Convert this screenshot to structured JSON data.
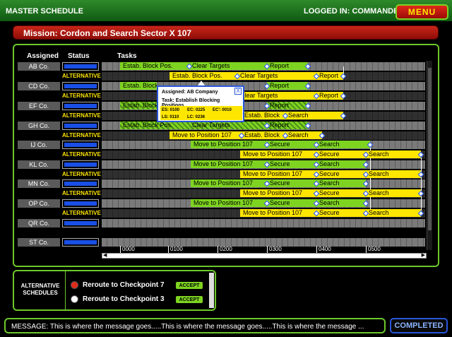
{
  "header": {
    "title": "MASTER SCHEDULE",
    "login": "LOGGED IN: COMMANDER",
    "menu_label": "MENU"
  },
  "mission": {
    "title": "Mission: Cordon and Search Sector X 107"
  },
  "columns": {
    "assigned": "Assigned",
    "status": "Status",
    "tasks": "Tasks"
  },
  "rows": [
    {
      "unit": "AB Co.",
      "alt": "ALTERNATIVE"
    },
    {
      "unit": "CD Co.",
      "alt": "ALTERNATIVE"
    },
    {
      "unit": "EF Co.",
      "alt": "ALTERNATIVE"
    },
    {
      "unit": "GH Co.",
      "alt": "ALTERNATIVE"
    },
    {
      "unit": "IJ Co.",
      "alt": "ALTERNATIVE"
    },
    {
      "unit": "KL Co.",
      "alt": "ALTERNATIVE"
    },
    {
      "unit": "MN Co.",
      "alt": "ALTERNATIVE"
    },
    {
      "unit": "OP Co.",
      "alt": "ALTERNATIVE"
    },
    {
      "unit": "QR Co."
    },
    {
      "unit": "ST Co."
    }
  ],
  "tasks": {
    "estab_block": "Estab. Block Pos.",
    "clear_targets": "Clear Targets",
    "report": "Report",
    "estab_block_short": "Estab. Block",
    "search": "Search",
    "move": "Move to Position 107",
    "secure": "Secure"
  },
  "time_ticks": [
    "0000",
    "0100",
    "0200",
    "0300",
    "0400",
    "0500"
  ],
  "popup": {
    "assigned": "Assigned: AB Company",
    "task": "Task: Establish Blocking Positions",
    "es": "ES: 0100",
    "ec": "EC: 0225",
    "ec2": "EC': 0010",
    "ls": "LS: 0110",
    "lc": "LC: 0236",
    "close": "X"
  },
  "alternatives": {
    "title": "ALTERNATIVE SCHEDULES",
    "options": [
      {
        "label": "Reroute to Checkpoint 7",
        "accept": "ACCEPT",
        "dot_color": "#e02a1a"
      },
      {
        "label": "Reroute to Checkpoint 3",
        "accept": "ACCEPT",
        "dot_color": "#ffffff"
      }
    ]
  },
  "message": {
    "text": "MESSAGE: This is where the message goes.....This is where the message goes.....This is where the message ..."
  },
  "completed_label": "COMPLETED",
  "colors": {
    "green": "#7ed321",
    "yellow": "#ffe600",
    "accent_red": "#c9261a",
    "status_blue": "#1a4fe6"
  }
}
